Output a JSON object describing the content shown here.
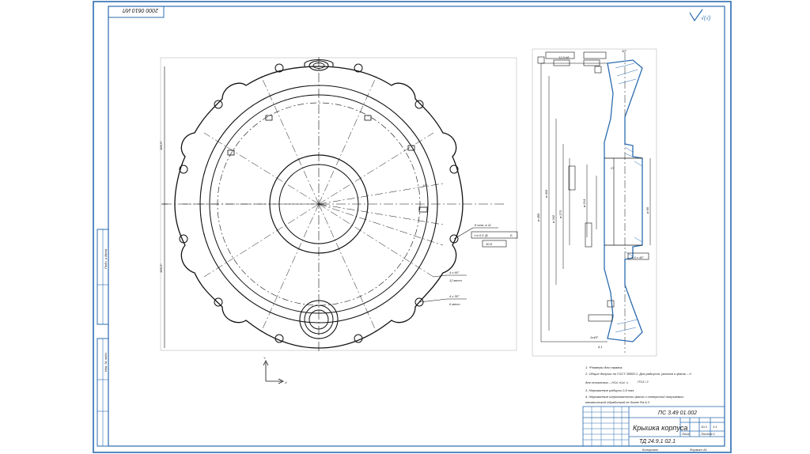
{
  "stamp_top": "2000 0610 ИЛ",
  "roughness": "√(√)",
  "front_view": {
    "dim_left_upper": "189,5*",
    "dim_left_lower": "189,5*",
    "callout_holes": "8 отв. ø 11",
    "callout_holes_tol": "⌖ ø 0,5 Ⓜ",
    "callout_holes_ref": "Б",
    "callout_holes_extra": "30 Б",
    "angle_label": "15°",
    "angle_1": "4 х 60°",
    "angle_1_note": "12 мест",
    "angle_2": "4 х 30°",
    "angle_2_note": "6 мест"
  },
  "side_view": {
    "dims": [
      "ø 485",
      "ø 406",
      "ø 342",
      "ø 273",
      "ø 214",
      "ø 86",
      "27",
      "30°",
      "4,5 х 45°",
      "12,5 h8"
    ],
    "bottom_left": "1х45°",
    "bottom_dim": "6,1"
  },
  "notes": [
    "1. *Размеры для справок.",
    "2. Общие допуски по ГОСТ 30893.1. Для радиусов, уклонов и фасок – h",
    "   для остальных – H14, h14, ±",
    "3. Неуказанные радиусы 2,8 max.",
    "4. Неуказанные шероховатость фасок и отверстий получаемых",
    "   механической обработкой не более Ra 6,3"
  ],
  "note_fraction": "IT14 / 2",
  "title_block": {
    "doc_number": "ПС 3.49 01.002",
    "name": "Крышка корпуса",
    "material": "ТД 24.9.1 02.1",
    "mass": "10,3",
    "scale": "1:1",
    "sheet": "Лист",
    "sheets": "Листов  1",
    "copied": "Копировал",
    "format": "Формат  A1"
  },
  "axis_y": "Y",
  "axis_x": "X",
  "side_stamp_upper": "Подп. и дата",
  "side_stamp_lower": "Инв. № подл."
}
